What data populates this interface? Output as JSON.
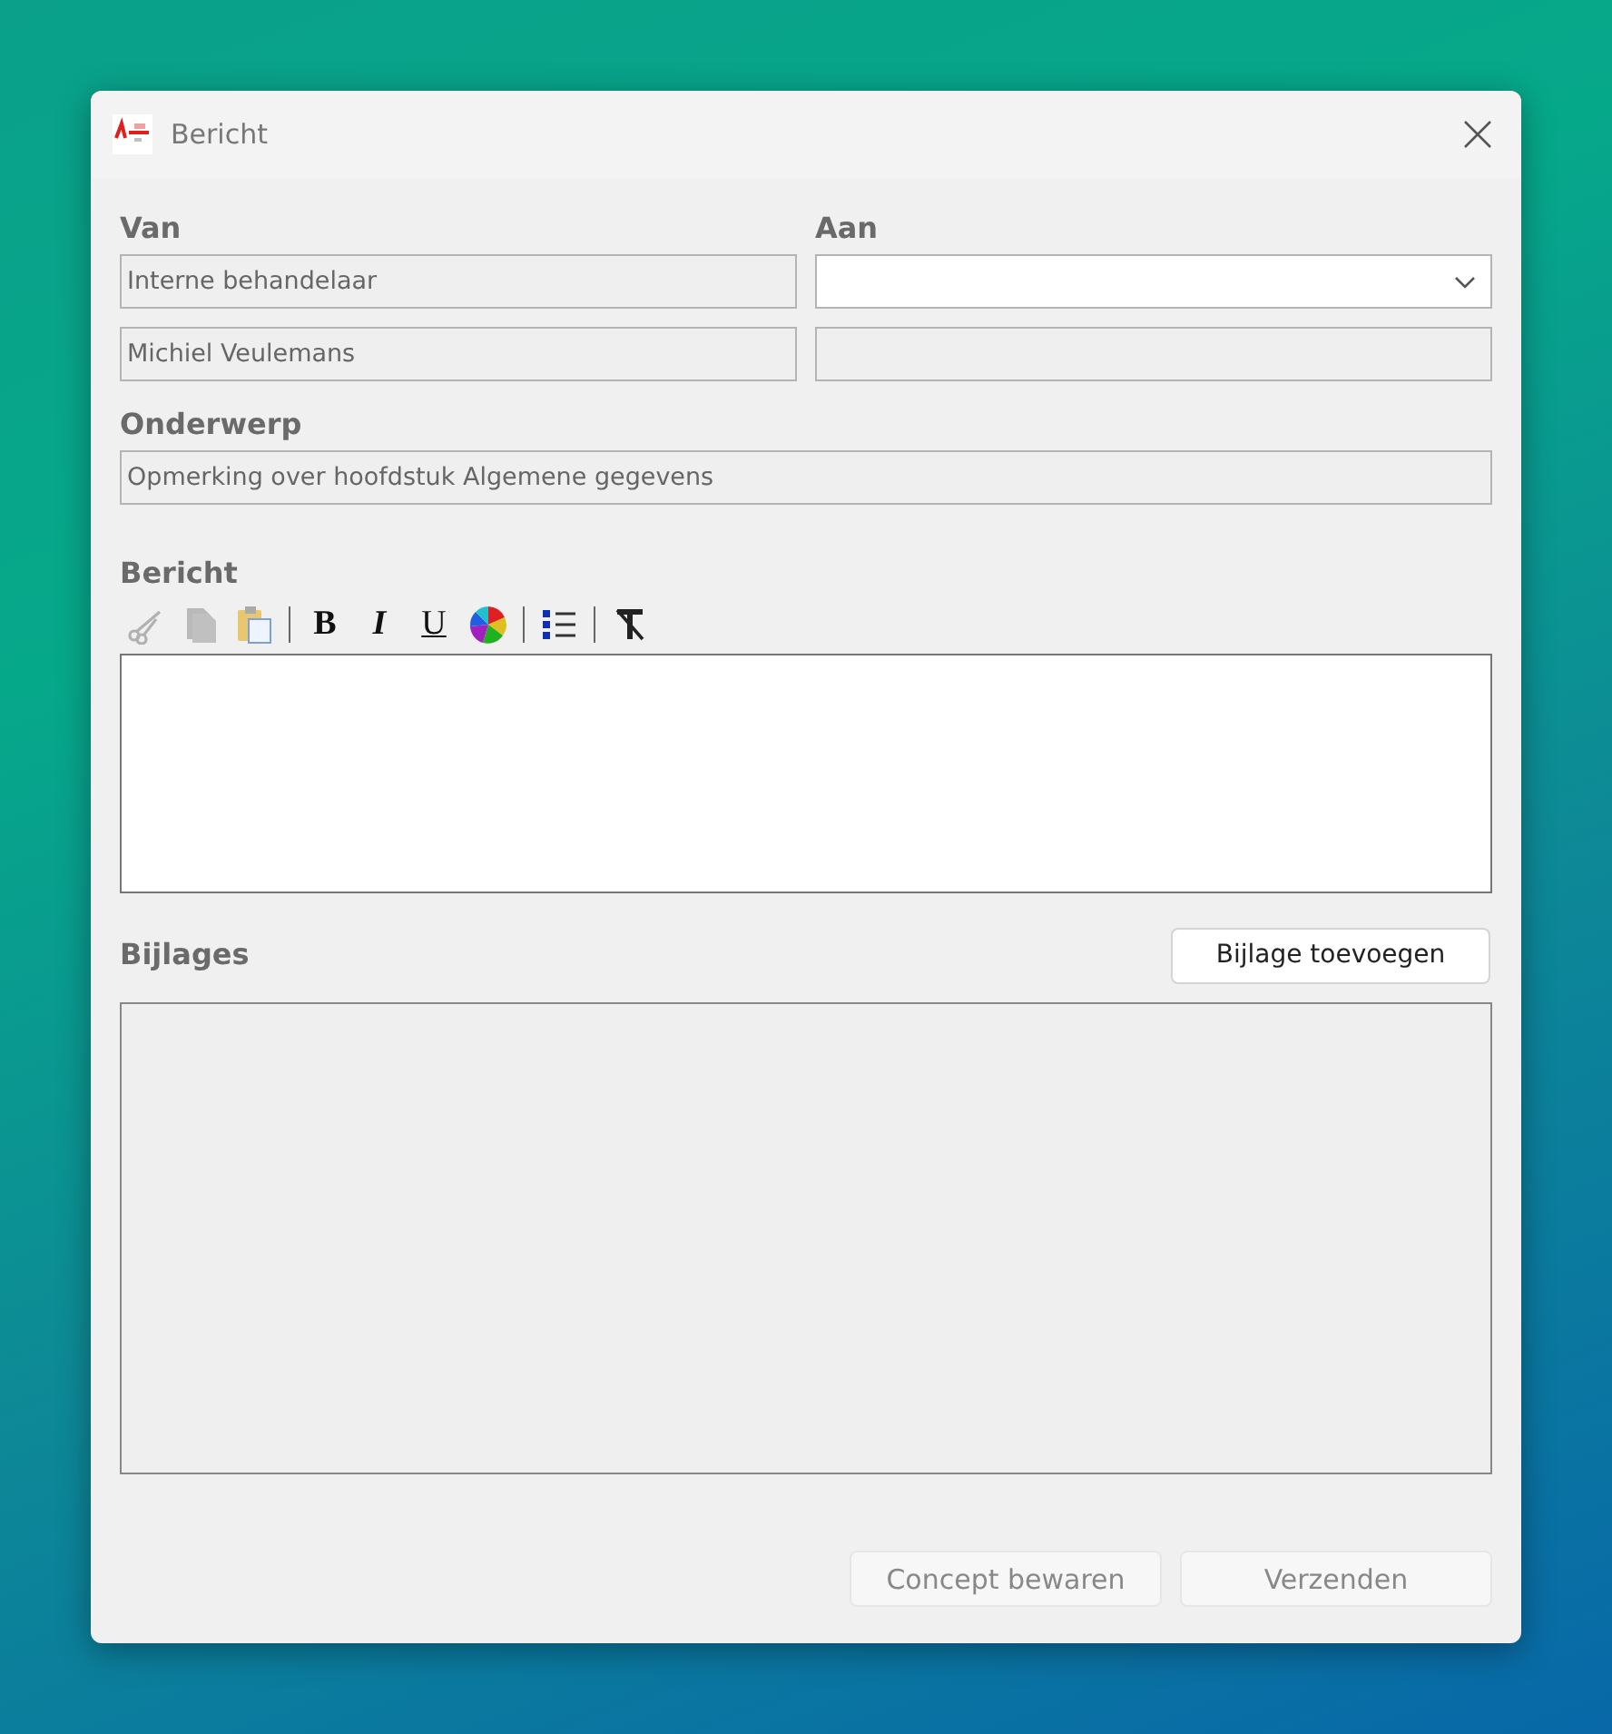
{
  "window": {
    "title": "Bericht"
  },
  "from": {
    "label": "Van",
    "fields": [
      {
        "value": "Interne behandelaar",
        "disabled": true
      },
      {
        "value": "Michiel Veulemans",
        "disabled": true
      }
    ]
  },
  "to": {
    "label": "Aan",
    "dropdown": {
      "disabled": false
    },
    "field": {
      "disabled": true
    }
  },
  "subject": {
    "label": "Onderwerp",
    "field": {
      "value": "Opmerking over hoofdstuk Algemene gegevens",
      "disabled": true
    }
  },
  "message": {
    "label": "Bericht",
    "toolbar": [
      {
        "kind": "cut",
        "disabled": true
      },
      {
        "kind": "copy",
        "disabled": true
      },
      {
        "kind": "paste",
        "disabled": false
      },
      {
        "kind": "separator"
      },
      {
        "kind": "bold",
        "text": "B",
        "disabled": false
      },
      {
        "kind": "italic",
        "text": "I",
        "disabled": false
      },
      {
        "kind": "underline",
        "text": "U",
        "disabled": false
      },
      {
        "kind": "color",
        "disabled": false
      },
      {
        "kind": "separator"
      },
      {
        "kind": "list",
        "disabled": false
      },
      {
        "kind": "separator"
      },
      {
        "kind": "clear",
        "disabled": false
      }
    ]
  },
  "attachments": {
    "label": "Bijlages",
    "add_button": {
      "label": "Bijlage toevoegen",
      "disabled": false
    }
  },
  "buttons": [
    {
      "label": "Concept bewaren",
      "disabled": true
    },
    {
      "label": "Verzenden",
      "disabled": true
    }
  ]
}
